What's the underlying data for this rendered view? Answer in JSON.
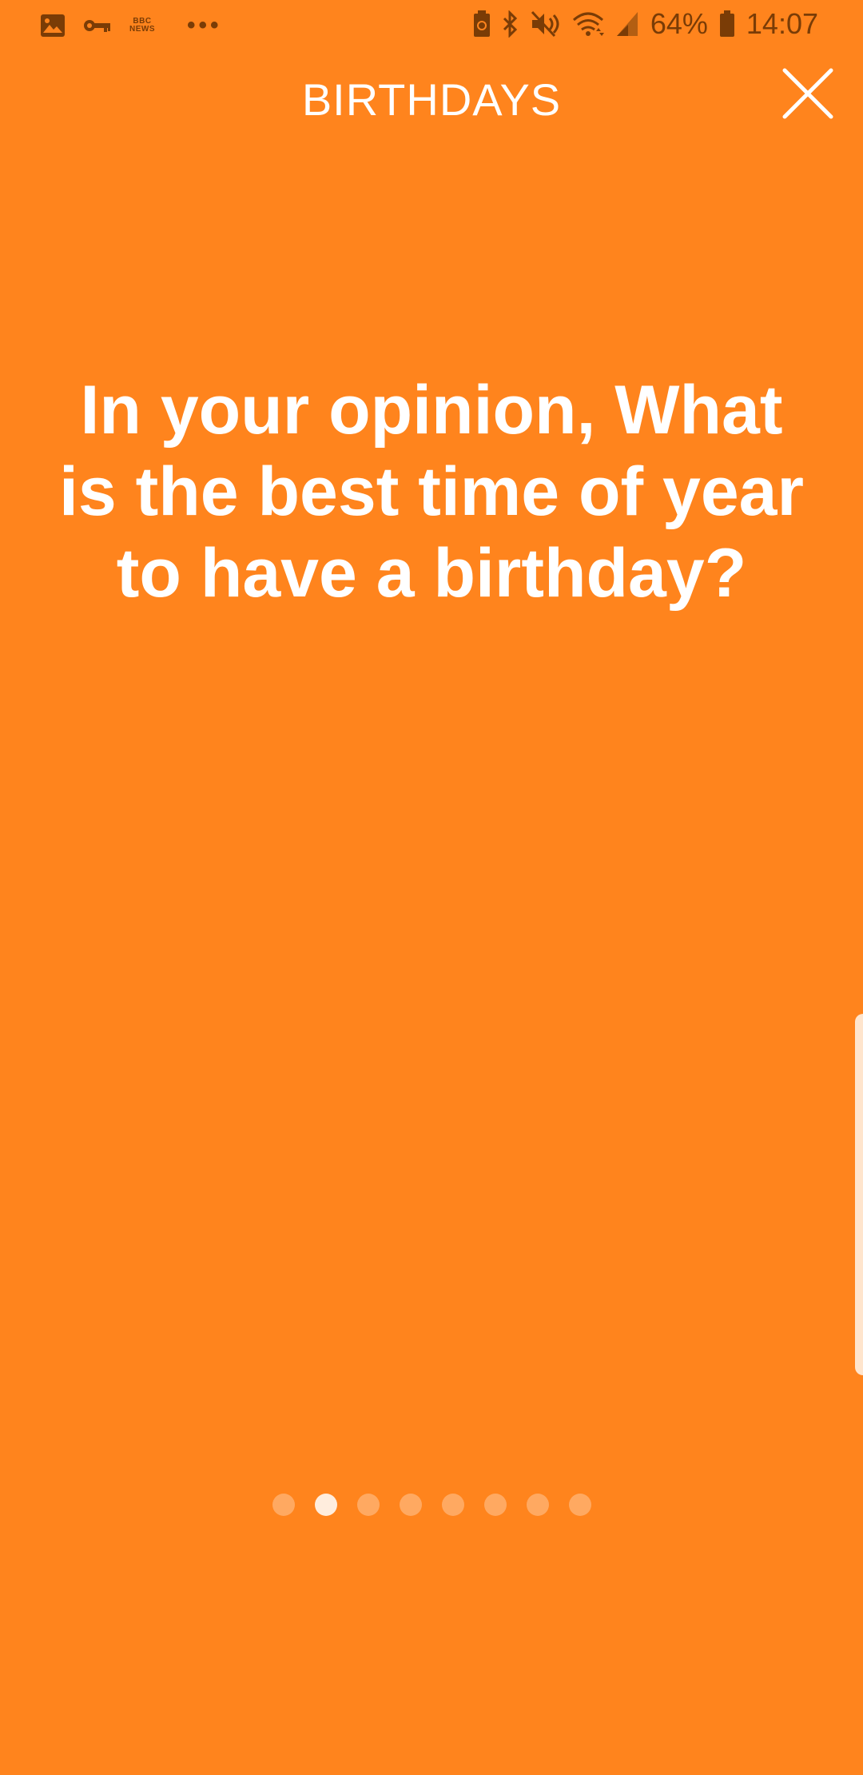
{
  "status_bar": {
    "left_icons": [
      "image-icon",
      "key-icon",
      "bbc-news-icon",
      "more-notifications-icon"
    ],
    "news_label_top": "BBC",
    "news_label_bottom": "NEWS",
    "more_label": "•••",
    "right_icons": [
      "battery-saver-icon",
      "bluetooth-icon",
      "mute-icon",
      "wifi-icon",
      "signal-icon",
      "battery-icon"
    ],
    "battery_percent": "64%",
    "time": "14:07",
    "color": "#7a3c06"
  },
  "header": {
    "title": "BIRTHDAYS",
    "close_icon": "close-icon"
  },
  "card": {
    "question": "In your opinion, What is the best time of year to have a birthday?"
  },
  "pager": {
    "total_pages": 8,
    "current_page": 2
  },
  "colors": {
    "background": "#FF841D",
    "text": "#FFFFFF"
  }
}
